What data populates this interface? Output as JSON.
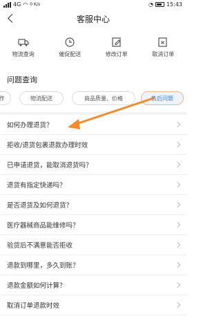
{
  "status_bar": {
    "carrier": "4G",
    "speed": "0 K/s",
    "time": "15:43"
  },
  "header": {
    "title": "客服中心"
  },
  "quick_actions": [
    {
      "label": "物流查询",
      "icon": "truck-icon"
    },
    {
      "label": "催促配送",
      "icon": "clock-icon"
    },
    {
      "label": "修改订单",
      "icon": "edit-icon"
    },
    {
      "label": "取消订单",
      "icon": "cancel-icon"
    }
  ],
  "section": {
    "title": "问题查询"
  },
  "tabs": [
    {
      "label": "作"
    },
    {
      "label": "物流配送"
    },
    {
      "label": "商品质量、价格"
    },
    {
      "label": "售后问题",
      "active": true
    }
  ],
  "questions": [
    "如何办理退货？",
    "拒收/退货包裹退款办理时效",
    "已申请退货，能取消退货吗？",
    "退货有指定快递吗？",
    "是否退货及如何退货？",
    "医疗器械商品能维修吗？",
    "验货后不满意能否拒收",
    "退款到哪里，多久到账？",
    "退款金额如何计算？",
    "取消订单退款时效"
  ],
  "colors": {
    "accent": "#3b7ed8",
    "annotation_arrow": "#f28a2e"
  }
}
